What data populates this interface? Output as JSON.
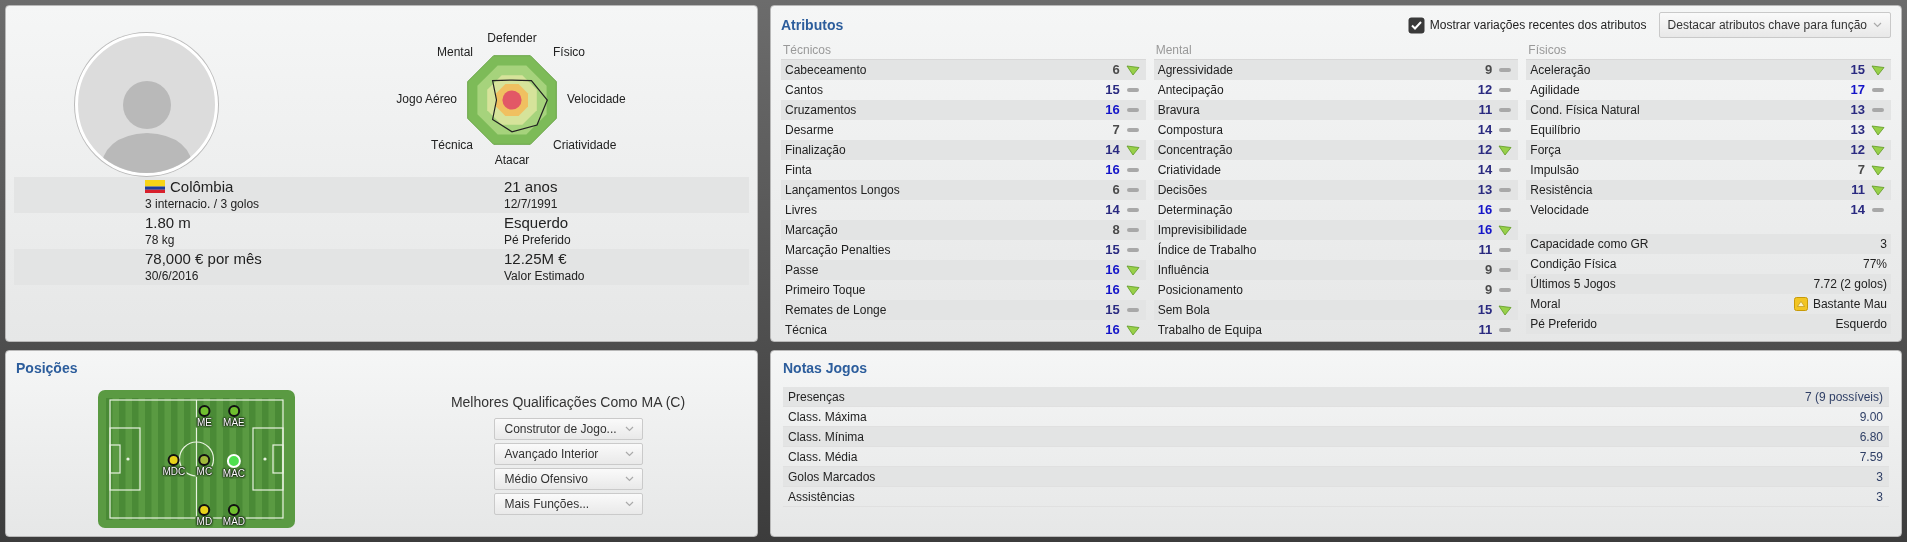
{
  "player_panel": {
    "radar_labels": [
      "Defender",
      "Mental",
      "Físico",
      "Jogo Aéreo",
      "Velocidade",
      "Técnica",
      "Criatividade",
      "Atacar"
    ],
    "info": [
      {
        "kind": "nationality",
        "main": "Colômbia",
        "sub": "3 internacio. / 3 golos"
      },
      {
        "kind": "plain",
        "main": "21 anos",
        "sub": "12/7/1991"
      },
      {
        "kind": "plain",
        "main": "1.80 m",
        "sub": "78 kg"
      },
      {
        "kind": "plain",
        "main": "Esquerdo",
        "sub": "Pé Preferido"
      },
      {
        "kind": "plain",
        "main": "78,000 € por mês",
        "sub": "30/6/2016"
      },
      {
        "kind": "plain",
        "main": "12.25M €",
        "sub": "Valor Estimado"
      }
    ]
  },
  "attributes": {
    "title": "Atributos",
    "show_changes": {
      "label": "Mostrar variações recentes dos atributos",
      "checked": true
    },
    "highlight_button": "Destacar atributos chave para função",
    "columns": [
      {
        "heading": "Técnicos",
        "items": [
          {
            "name": "Cabeceamento",
            "value": "6",
            "color": "#4a4a4a",
            "trend_up": true
          },
          {
            "name": "Cantos",
            "value": "15",
            "color": "#2a2a80",
            "trend_up": false
          },
          {
            "name": "Cruzamentos",
            "value": "16",
            "color": "#1414c8",
            "trend_up": false
          },
          {
            "name": "Desarme",
            "value": "7",
            "color": "#4a4a4a",
            "trend_up": false
          },
          {
            "name": "Finalização",
            "value": "14",
            "color": "#2a2a80",
            "trend_up": true
          },
          {
            "name": "Finta",
            "value": "16",
            "color": "#1414c8",
            "trend_up": false
          },
          {
            "name": "Lançamentos Longos",
            "value": "6",
            "color": "#4a4a4a",
            "trend_up": false
          },
          {
            "name": "Livres",
            "value": "14",
            "color": "#2a2a80",
            "trend_up": false
          },
          {
            "name": "Marcação",
            "value": "8",
            "color": "#4a4a4a",
            "trend_up": false
          },
          {
            "name": "Marcação Penalties",
            "value": "15",
            "color": "#2a2a80",
            "trend_up": false
          },
          {
            "name": "Passe",
            "value": "16",
            "color": "#1414c8",
            "trend_up": true
          },
          {
            "name": "Primeiro Toque",
            "value": "16",
            "color": "#1414c8",
            "trend_up": true
          },
          {
            "name": "Remates de Longe",
            "value": "15",
            "color": "#2a2a80",
            "trend_up": false
          },
          {
            "name": "Técnica",
            "value": "16",
            "color": "#1414c8",
            "trend_up": true
          }
        ]
      },
      {
        "heading": "Mental",
        "items": [
          {
            "name": "Agressividade",
            "value": "9",
            "color": "#4a4a4a",
            "trend_up": false
          },
          {
            "name": "Antecipação",
            "value": "12",
            "color": "#2a2a80",
            "trend_up": false
          },
          {
            "name": "Bravura",
            "value": "11",
            "color": "#2a2a80",
            "trend_up": false
          },
          {
            "name": "Compostura",
            "value": "14",
            "color": "#2a2a80",
            "trend_up": false
          },
          {
            "name": "Concentração",
            "value": "12",
            "color": "#2a2a80",
            "trend_up": true
          },
          {
            "name": "Criatividade",
            "value": "14",
            "color": "#2a2a80",
            "trend_up": false
          },
          {
            "name": "Decisões",
            "value": "13",
            "color": "#2a2a80",
            "trend_up": false
          },
          {
            "name": "Determinação",
            "value": "16",
            "color": "#1414c8",
            "trend_up": false
          },
          {
            "name": "Imprevisibilidade",
            "value": "16",
            "color": "#1414c8",
            "trend_up": true
          },
          {
            "name": "Índice de Trabalho",
            "value": "11",
            "color": "#2a2a80",
            "trend_up": false
          },
          {
            "name": "Influência",
            "value": "9",
            "color": "#4a4a4a",
            "trend_up": false
          },
          {
            "name": "Posicionamento",
            "value": "9",
            "color": "#4a4a4a",
            "trend_up": false
          },
          {
            "name": "Sem Bola",
            "value": "15",
            "color": "#2a2a80",
            "trend_up": true
          },
          {
            "name": "Trabalho de Equipa",
            "value": "11",
            "color": "#2a2a80",
            "trend_up": false
          }
        ]
      },
      {
        "heading": "Físicos",
        "items": [
          {
            "name": "Aceleração",
            "value": "15",
            "color": "#2a2a80",
            "trend_up": true
          },
          {
            "name": "Agilidade",
            "value": "17",
            "color": "#1414c8",
            "trend_up": false
          },
          {
            "name": "Cond. Física Natural",
            "value": "13",
            "color": "#2a2a80",
            "trend_up": false
          },
          {
            "name": "Equilíbrio",
            "value": "13",
            "color": "#2a2a80",
            "trend_up": true
          },
          {
            "name": "Força",
            "value": "12",
            "color": "#2a2a80",
            "trend_up": true
          },
          {
            "name": "Impulsão",
            "value": "7",
            "color": "#4a4a4a",
            "trend_up": true
          },
          {
            "name": "Resistência",
            "value": "11",
            "color": "#2a2a80",
            "trend_up": true
          },
          {
            "name": "Velocidade",
            "value": "14",
            "color": "#2a2a80",
            "trend_up": false
          }
        ]
      }
    ],
    "extra": [
      {
        "kind": "plain",
        "label": "Capacidade como GR",
        "value": "3"
      },
      {
        "kind": "plain",
        "label": "Condição Física",
        "value": "77%"
      },
      {
        "kind": "plain",
        "label": "Últimos 5 Jogos",
        "value": "7.72 (2 golos)"
      },
      {
        "kind": "morale",
        "label": "Moral",
        "value": "Bastante Mau"
      },
      {
        "kind": "plain",
        "label": "Pé Preferido",
        "value": "Esquerdo"
      }
    ]
  },
  "positions": {
    "title": "Posições",
    "pitch": [
      {
        "label": "ME",
        "color": "#6fbf2e",
        "selected": false
      },
      {
        "label": "MAE",
        "color": "#6fbf2e",
        "selected": false
      },
      {
        "label": "MDC",
        "color": "#e8d21a",
        "selected": false
      },
      {
        "label": "MC",
        "color": "#9fb83a",
        "selected": false
      },
      {
        "label": "MAC",
        "color": "#4ee04e",
        "selected": true
      },
      {
        "label": "MD",
        "color": "#e8d21a",
        "selected": false
      },
      {
        "label": "MAD",
        "color": "#6fbf2e",
        "selected": false
      }
    ],
    "roles_title": "Melhores Qualificações Como MA (C)",
    "roles": [
      "Construtor de Jogo...",
      "Avançado Interior",
      "Médio Ofensivo",
      "Mais Funções..."
    ]
  },
  "match_stats": {
    "title": "Notas Jogos",
    "rows": [
      {
        "label": "Presenças",
        "value": "7 (9 possíveis)"
      },
      {
        "label": "Class. Máxima",
        "value": "9.00"
      },
      {
        "label": "Class. Mínima",
        "value": "6.80"
      },
      {
        "label": "Class. Média",
        "value": "7.59"
      },
      {
        "label": "Golos Marcados",
        "value": "3"
      },
      {
        "label": "Assistências",
        "value": "3"
      }
    ]
  }
}
